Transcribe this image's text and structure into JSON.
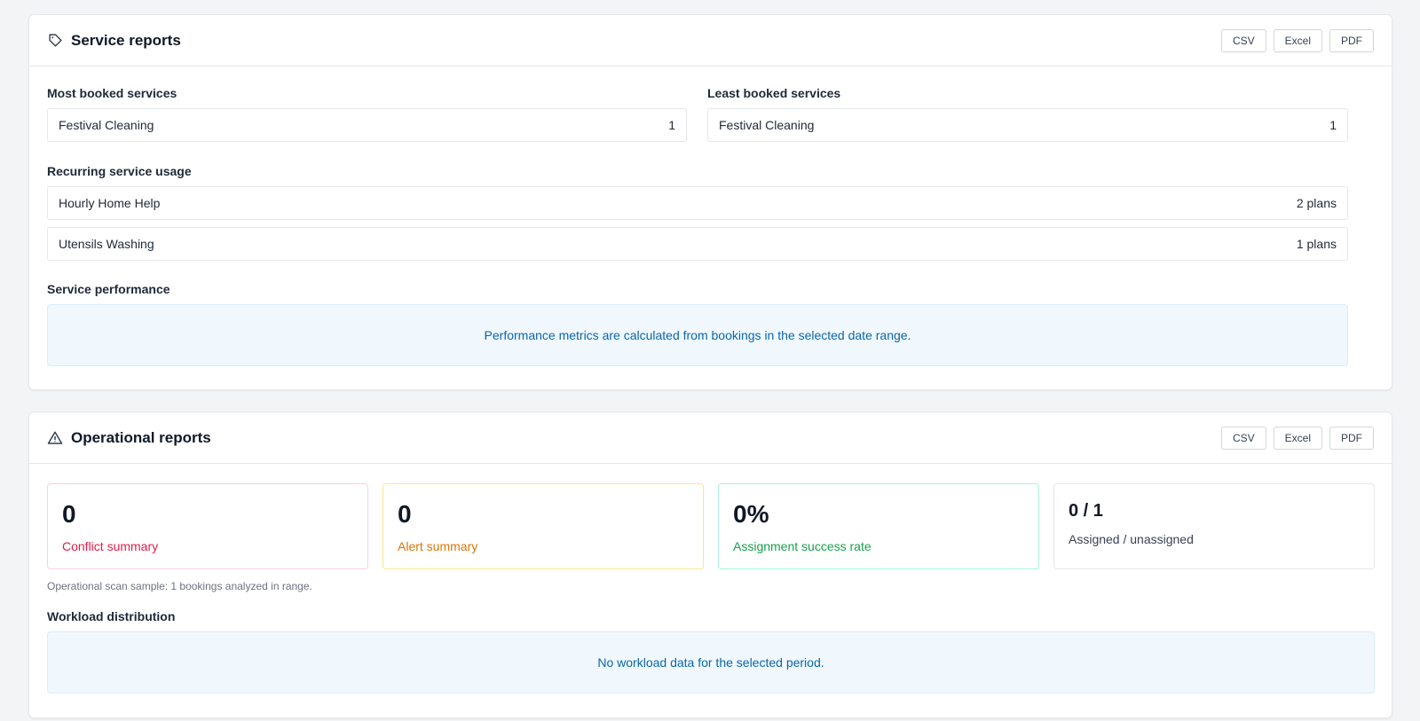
{
  "service_reports": {
    "title": "Service reports",
    "exports": [
      "CSV",
      "Excel",
      "PDF"
    ],
    "most_booked": {
      "label": "Most booked services",
      "items": [
        {
          "name": "Festival Cleaning",
          "count": "1"
        }
      ]
    },
    "least_booked": {
      "label": "Least booked services",
      "items": [
        {
          "name": "Festival Cleaning",
          "count": "1"
        }
      ]
    },
    "recurring": {
      "label": "Recurring service usage",
      "items": [
        {
          "name": "Hourly Home Help",
          "count": "2 plans"
        },
        {
          "name": "Utensils Washing",
          "count": "1 plans"
        }
      ]
    },
    "performance": {
      "label": "Service performance",
      "message": "Performance metrics are calculated from bookings in the selected date range."
    }
  },
  "operational_reports": {
    "title": "Operational reports",
    "exports": [
      "CSV",
      "Excel",
      "PDF"
    ],
    "stats": [
      {
        "value": "0",
        "label": "Conflict summary"
      },
      {
        "value": "0",
        "label": "Alert summary"
      },
      {
        "value": "0%",
        "label": "Assignment success rate"
      },
      {
        "value": "0 / 1",
        "label": "Assigned / unassigned"
      }
    ],
    "note": "Operational scan sample: 1 bookings analyzed in range.",
    "workload": {
      "label": "Workload distribution",
      "message": "No workload data for the selected period."
    }
  },
  "colors": {
    "conflict": "#e11d48",
    "alert": "#d97706",
    "success": "#16a34a",
    "info_text": "#0b66a8",
    "info_bg": "#f0f8fe"
  },
  "icons": {
    "service_header": "tag-icon",
    "ops_header": "warning-triangle-icon"
  }
}
